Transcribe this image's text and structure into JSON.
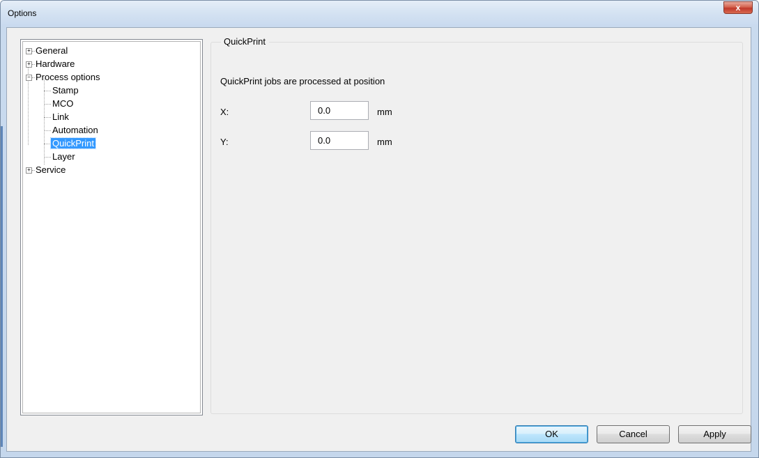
{
  "window": {
    "title": "Options",
    "close_glyph": "x"
  },
  "tree": {
    "items": [
      {
        "label": "General",
        "expander": "+"
      },
      {
        "label": "Hardware",
        "expander": "+"
      },
      {
        "label": "Process options",
        "expander": "−"
      },
      {
        "label": "Stamp"
      },
      {
        "label": "MCO"
      },
      {
        "label": "Link"
      },
      {
        "label": "Automation"
      },
      {
        "label": "QuickPrint",
        "selected": true
      },
      {
        "label": "Layer"
      },
      {
        "label": "Service",
        "expander": "+"
      }
    ]
  },
  "panel": {
    "group_title": "QuickPrint",
    "description": "QuickPrint jobs are processed at position",
    "x_label": "X:",
    "x_value": "0.0",
    "x_unit": "mm",
    "y_label": "Y:",
    "y_value": "0.0",
    "y_unit": "mm"
  },
  "buttons": {
    "ok": "OK",
    "cancel": "Cancel",
    "apply": "Apply"
  },
  "colors": {
    "selection": "#3399ff",
    "close_button": "#c0392b",
    "default_button_border": "#3c7fb1"
  },
  "icons": {
    "close": "close-icon",
    "expand": "plus-box-icon",
    "collapse": "minus-box-icon"
  }
}
